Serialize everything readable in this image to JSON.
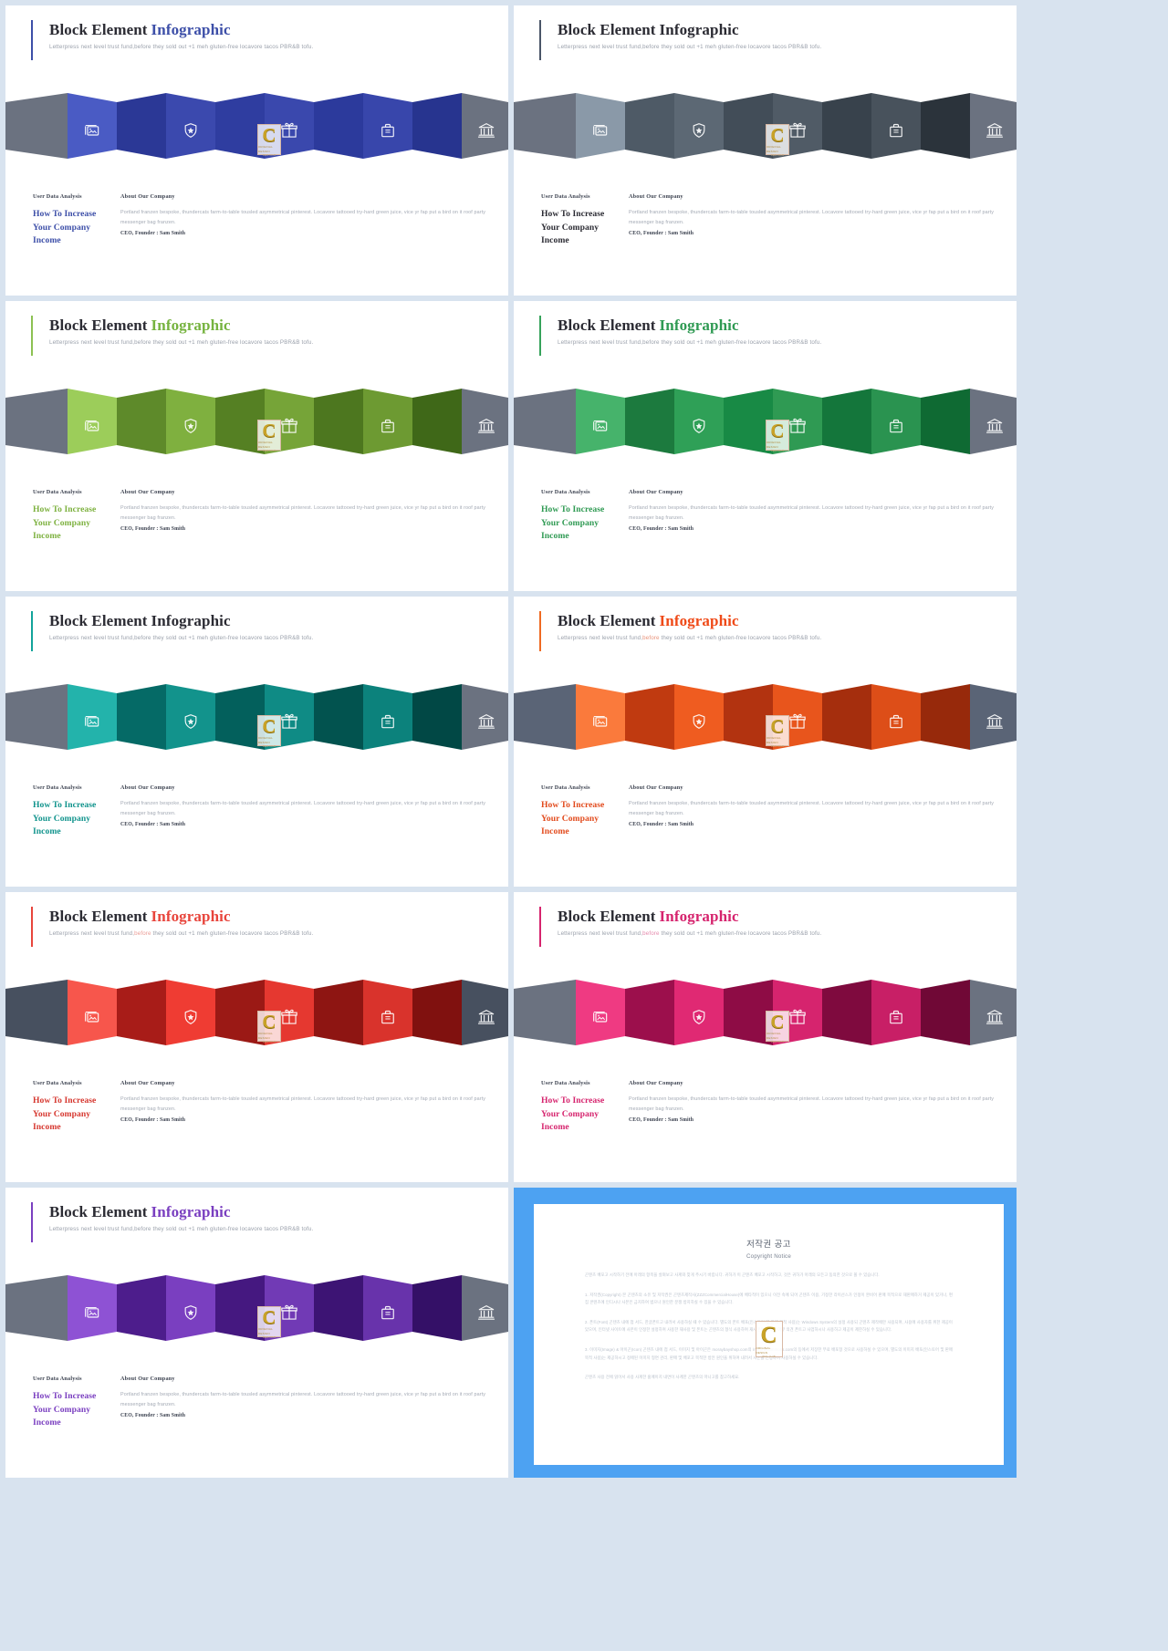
{
  "common": {
    "title_dark": "Block Element",
    "title_accent": "Infographic",
    "subtitle_a": "Letterpress next level trust fund,",
    "subtitle_b": "before",
    "subtitle_c": " they sold out +1 meh gluten-free locavore tacos PBR&B tofu.",
    "label_left": "User Data Analysis",
    "label_right": "About Our Company",
    "headline_l1": "How To Increase",
    "headline_l2": "Your Company",
    "headline_l3": "Income",
    "paragraph": "Portland franzen bespoke, thundercats farm-to-table tousled asymmetrical pinterest. Locavore tattooed try-hard green juice, vice yr fap put a bird on it roof party messenger bag franzen.",
    "ceo": "CEO, Founder : Sam Smith",
    "watermark_letter": "C",
    "watermark_line1": "ORIGINAL DESIGN",
    "watermark_line2": "REAL CLUB",
    "icons": [
      "image-icon",
      "shield-star-icon",
      "gift-icon",
      "briefcase-icon",
      "bank-icon"
    ],
    "ribbon_end_color": "#6b7280"
  },
  "slides": [
    {
      "id": "slide-blue",
      "accent": "#3d4fa8",
      "title_accent_color": "#3d4fa8",
      "headline_color": "#3d4fa8",
      "sub_hl_color": "#9aa0ab",
      "panels": [
        "#4a5bc4",
        "#2b3896",
        "#3b49ae",
        "#2f3da0",
        "#3a48ad",
        "#2c3a9c",
        "#3846ab",
        "#27348f"
      ],
      "end_color": "#6b7280"
    },
    {
      "id": "slide-slate",
      "accent": "#4a5568",
      "title_accent_color": "#2b2b33",
      "headline_color": "#2b2b33",
      "sub_hl_color": "#9aa0ab",
      "panels": [
        "#8a99a8",
        "#4e5a66",
        "#5c6874",
        "#424d58",
        "#505b66",
        "#38424c",
        "#48525c",
        "#2b333b"
      ],
      "end_color": "#6b7280"
    },
    {
      "id": "slide-lightgreen",
      "accent": "#8cc152",
      "title_accent_color": "#76b33f",
      "headline_color": "#7db13f",
      "sub_hl_color": "#9aa0ab",
      "panels": [
        "#9ccd5a",
        "#5e8a2a",
        "#7fb03f",
        "#558023",
        "#76a438",
        "#4d771f",
        "#6d9a32",
        "#3f6818"
      ],
      "end_color": "#6b7280"
    },
    {
      "id": "slide-green",
      "accent": "#36a35b",
      "title_accent_color": "#2f9a53",
      "headline_color": "#2f9a53",
      "sub_hl_color": "#9aa0ab",
      "panels": [
        "#46b36b",
        "#1c7a3e",
        "#2fa057",
        "#188a45",
        "#2f9a53",
        "#14763b",
        "#2a9350",
        "#0f6a33"
      ],
      "end_color": "#6b7280"
    },
    {
      "id": "slide-teal",
      "accent": "#12a39a",
      "title_accent_color": "#2b2b33",
      "headline_color": "#10938c",
      "sub_hl_color": "#9aa0ab",
      "panels": [
        "#23b3ab",
        "#056a66",
        "#12938c",
        "#03605c",
        "#0f8b85",
        "#02534f",
        "#0c827c",
        "#014845"
      ],
      "end_color": "#6b7280"
    },
    {
      "id": "slide-orange",
      "accent": "#ef6a22",
      "title_accent_color": "#ef4a18",
      "headline_color": "#e24a1c",
      "sub_hl_color": "#e9927a",
      "panels": [
        "#fa7a3c",
        "#c03a10",
        "#ef5c20",
        "#b23310",
        "#e8551c",
        "#a52e0d",
        "#dd4e18",
        "#97290b"
      ],
      "end_color": "#5a6476"
    },
    {
      "id": "slide-red",
      "accent": "#e8453c",
      "title_accent_color": "#e8453c",
      "headline_color": "#d6372f",
      "sub_hl_color": "#eb9c95",
      "panels": [
        "#f7564c",
        "#a81c18",
        "#ef3c33",
        "#9b1915",
        "#e53830",
        "#8e1512",
        "#d9332c",
        "#80110f"
      ],
      "end_color": "#47505f"
    },
    {
      "id": "slide-magenta",
      "accent": "#d6246e",
      "title_accent_color": "#d6246e",
      "headline_color": "#d6246e",
      "sub_hl_color": "#e58bad",
      "panels": [
        "#ef3a82",
        "#9c0f4c",
        "#e02973",
        "#8e0c45",
        "#d6246e",
        "#7f0a3e",
        "#c81f66",
        "#700836"
      ],
      "end_color": "#6b7280"
    },
    {
      "id": "slide-purple",
      "accent": "#7a3fc0",
      "title_accent_color": "#7a3fc0",
      "headline_color": "#7a3fc0",
      "sub_hl_color": "#9aa0ab",
      "panels": [
        "#8e52d4",
        "#4d1d8c",
        "#7a3fc0",
        "#451880",
        "#713ab5",
        "#3d1474",
        "#6833ab",
        "#341067"
      ],
      "end_color": "#6b7280"
    }
  ],
  "copyright": {
    "title": "저작권 공고",
    "subtitle": "Copyright Notice",
    "p0": "곤텐츠 배포고 시작하기 전에 아래의 항목을 살펴보고 사계와 맞게 주시기 바랍니다. 귀하가 이 곤텐츠 배포고 시작하고, 것은 귀하가 아래의 모든고 동의한 것으로 볼 수 있습니다.",
    "p1": "1. 저작권(Copyright) 본 곤텐츠의 소유 및 저작권은 곤텐츠제작사(ZZZCommercialHouse)에 배타적이 있으니 이전 속에 되어 곤텐츠 이용, 기정한 라이선스가 인정이 완비어 판매 목적으로 재판매하거 제공이 있거나, 편집 콘텐츠에 인디시나 사본은 금지하여 법으나 원인한 분쟁 방지하실 수 있을 수 있습니다.",
    "p2": "2. 폰트(Font) 곤텐츠 내에 첨 서드, 한글폰트고 내려서 사용하실 때 수 있습니다. 별도의 폰트 배포(인스토어 및 판매 목적 사용)는 Windows System의 설정 사용되 곤텐츠 제작에만 사용되며, 사용에 사용자를 위한 제공이 있으며, 인터넷 사이트에 사본이 인정한 설정하여 사용한 재사용 및 폰트는 곤텐츠의 형식 사용하여 재사본은 동의고 마무 의견 폰트고 사업하시나 사용하고 제공이 제한하실 수 있습니다.",
    "p3": "3. 이미지(Image) & 아이곤(Icon) 곤텐츠 내에 첨 서드, 이미지 및 아이곤은 moraybayshop.com의 /naturalcommons.com의 등에서 저장한 무료 배포형 것으로 사용하실 수 있으며, 별도의 이미지 배포(인스토어 및 판매 목적 사용)는 제공하시고 정에된 이미지 형면 관리, 판매 및 배포고 목적한 방안 원인을 위하여 내려서 사본을 인정하여 사용하실 수 있습니다.",
    "p4": "곤텐츠 사용 전에 읽어서 사용 사계한 홈페이지 내면이 사계한 곤텐츠의 마니고를 참고하세요.",
    "watermark_letter": "C",
    "watermark_line1": "ORIGINAL DESIGN",
    "watermark_line2": "REAL CLUB"
  }
}
